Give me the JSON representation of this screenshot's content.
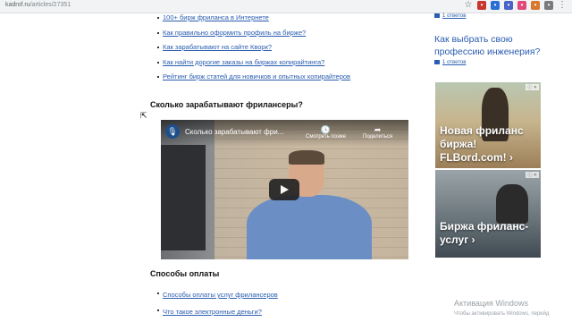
{
  "browser": {
    "url_host": "kadrof.ru",
    "url_path": "/articles/27351"
  },
  "article": {
    "top_links": [
      "100+ бирж фриланса в Интернете",
      "Как правильно оформить профиль на бирже?",
      "Как зарабатывают на сайте Кворк?",
      "Как найти дорогие заказы на биржах копирайтинга?",
      "Рейтинг бирж статей для новичков и опытных копирайтеров"
    ],
    "heading_earn": "Сколько зарабатывают фрилансеры?",
    "video": {
      "title": "Сколько зарабатывают фри...",
      "watch_later": "Смотреть позже",
      "share": "Поделиться"
    },
    "heading_pay": "Способы оплаты",
    "pay_links": [
      "Способы оплаты услуг фрилансеров",
      "Что такое электронные деньги?"
    ]
  },
  "sidebar": {
    "comments_1": "1 ответов",
    "title": "Как выбрать свою профессию инженерия?",
    "comments_2": "1 ответов",
    "ad1_text": "Новая фриланс\nбиржа!\nFLBord.com! ›",
    "ad2_text": "Биржа фриланс-\nуслуг ›"
  },
  "windows": {
    "activation_title": "Активация Windows",
    "activation_sub": "Чтобы активировать Windows, перейд"
  }
}
